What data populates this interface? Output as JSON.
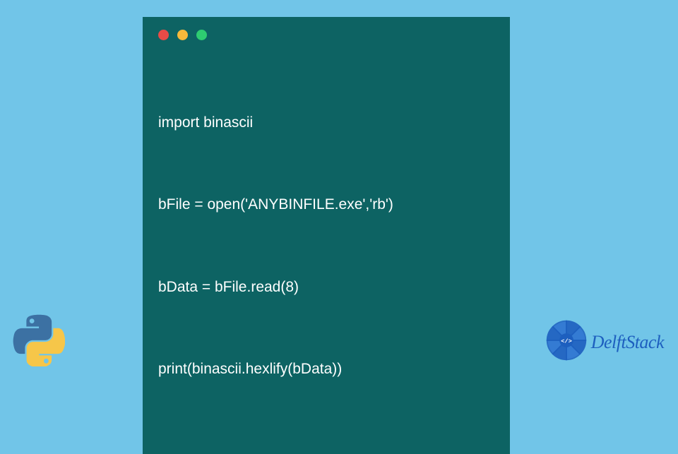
{
  "code": {
    "lines": [
      "import binascii",
      "bFile = open('ANYBINFILE.exe','rb')",
      "bData = bFile.read(8)",
      "print(binascii.hexlify(bData))"
    ]
  },
  "brand": {
    "name": "DelftStack"
  },
  "window": {
    "dot_red": "red",
    "dot_yellow": "yellow",
    "dot_green": "green"
  }
}
